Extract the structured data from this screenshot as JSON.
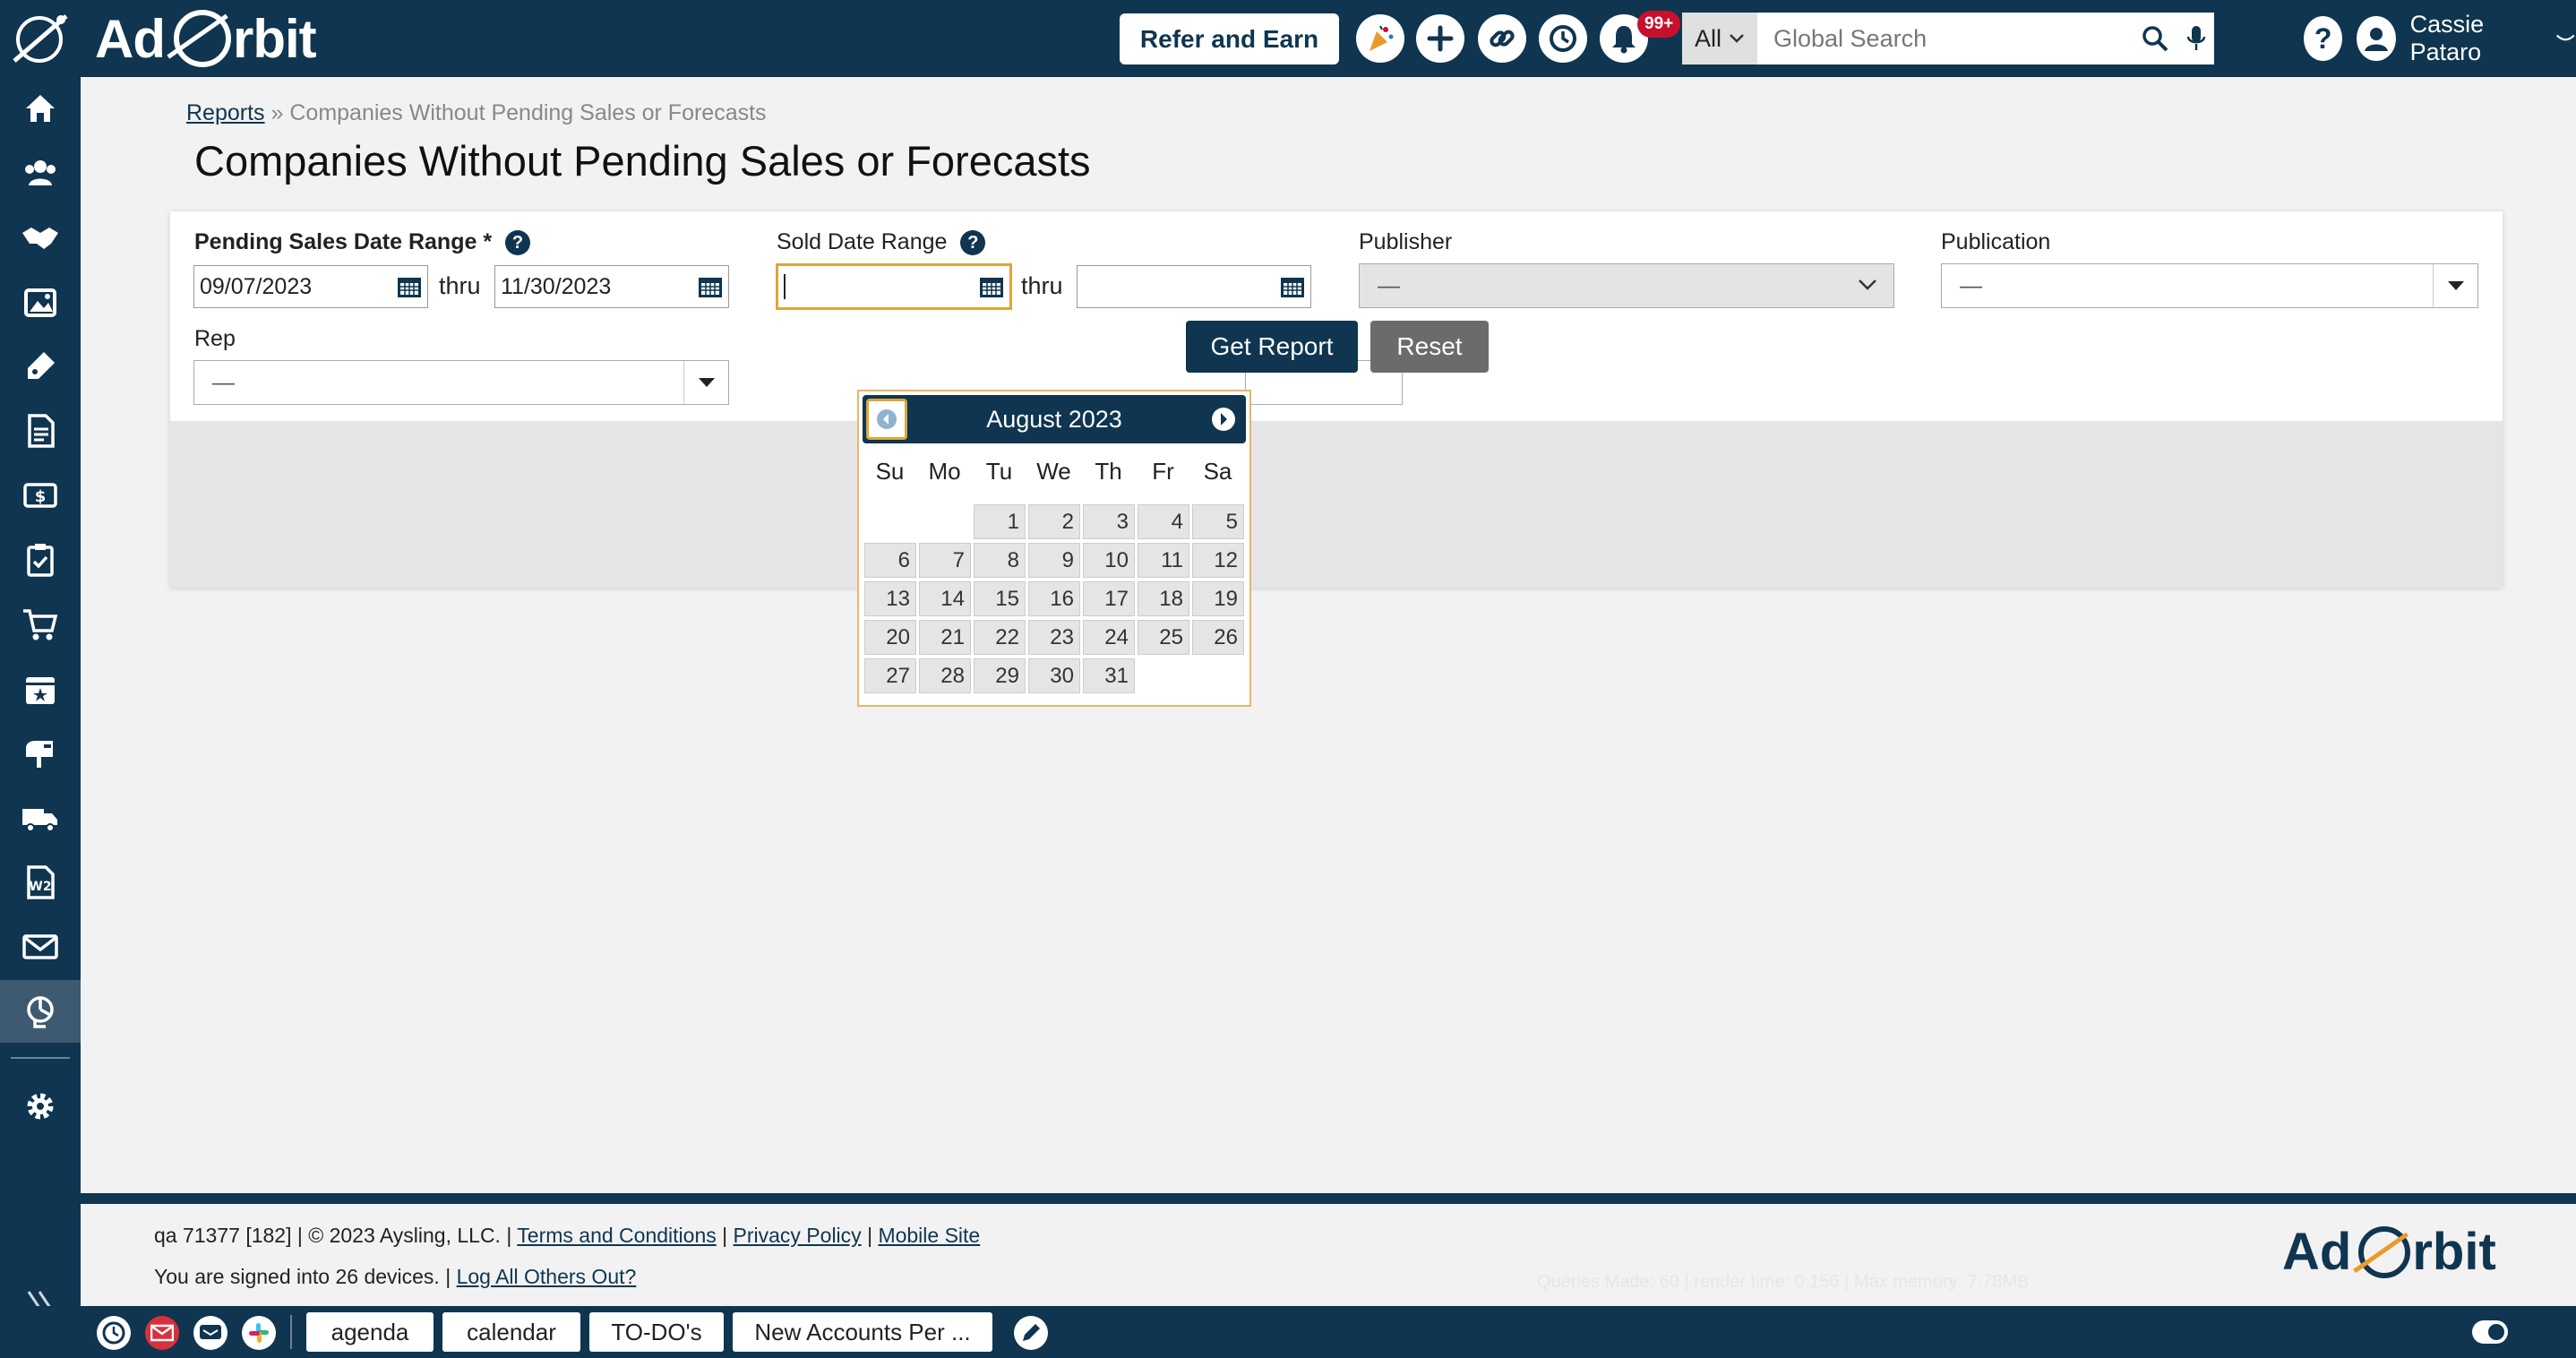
{
  "app": {
    "logo_text_left": "Ad",
    "logo_text_right": "rbit"
  },
  "topbar": {
    "refer_label": "Refer and Earn",
    "notification_count": "99+",
    "search_scope": "All",
    "search_placeholder": "Global Search",
    "user_name": "Cassie Pataro"
  },
  "breadcrumb": {
    "root": "Reports",
    "separator": "»",
    "current": "Companies Without Pending Sales or Forecasts"
  },
  "page": {
    "title": "Companies Without Pending Sales or Forecasts"
  },
  "form": {
    "pending_label": "Pending Sales Date Range *",
    "pending_from": "09/07/2023",
    "pending_to": "11/30/2023",
    "thru": "thru",
    "sold_label": "Sold Date Range",
    "sold_from": "",
    "sold_to": "",
    "publisher_label": "Publisher",
    "publisher_value": "—",
    "publication_label": "Publication",
    "publication_value": "—",
    "rep_label": "Rep",
    "rep_value": "—",
    "get_report": "Get Report",
    "reset": "Reset"
  },
  "datepicker": {
    "month_title": "August 2023",
    "weekdays": [
      "Su",
      "Mo",
      "Tu",
      "We",
      "Th",
      "Fr",
      "Sa"
    ],
    "first_weekday_index": 2,
    "days_in_month": 31
  },
  "footer": {
    "build": "qa 71377 [182] | © 2023 Aysling, LLC. |",
    "terms": "Terms and Conditions",
    "privacy": "Privacy Policy",
    "mobile": "Mobile Site",
    "sep": "|",
    "signed_in": "You are signed into 26 devices. |",
    "log_out_others": "Log All Others Out?",
    "debug": "Queries Made: 60 | render time: 0.156 | Max memory: 7.78MB"
  },
  "taskbar": {
    "items": [
      "agenda",
      "calendar",
      "TO-DO's",
      "New Accounts Per ..."
    ]
  },
  "colors": {
    "navy": "#0f3550",
    "badge_red": "#c8102e",
    "focus_orange": "#e0a43a"
  }
}
